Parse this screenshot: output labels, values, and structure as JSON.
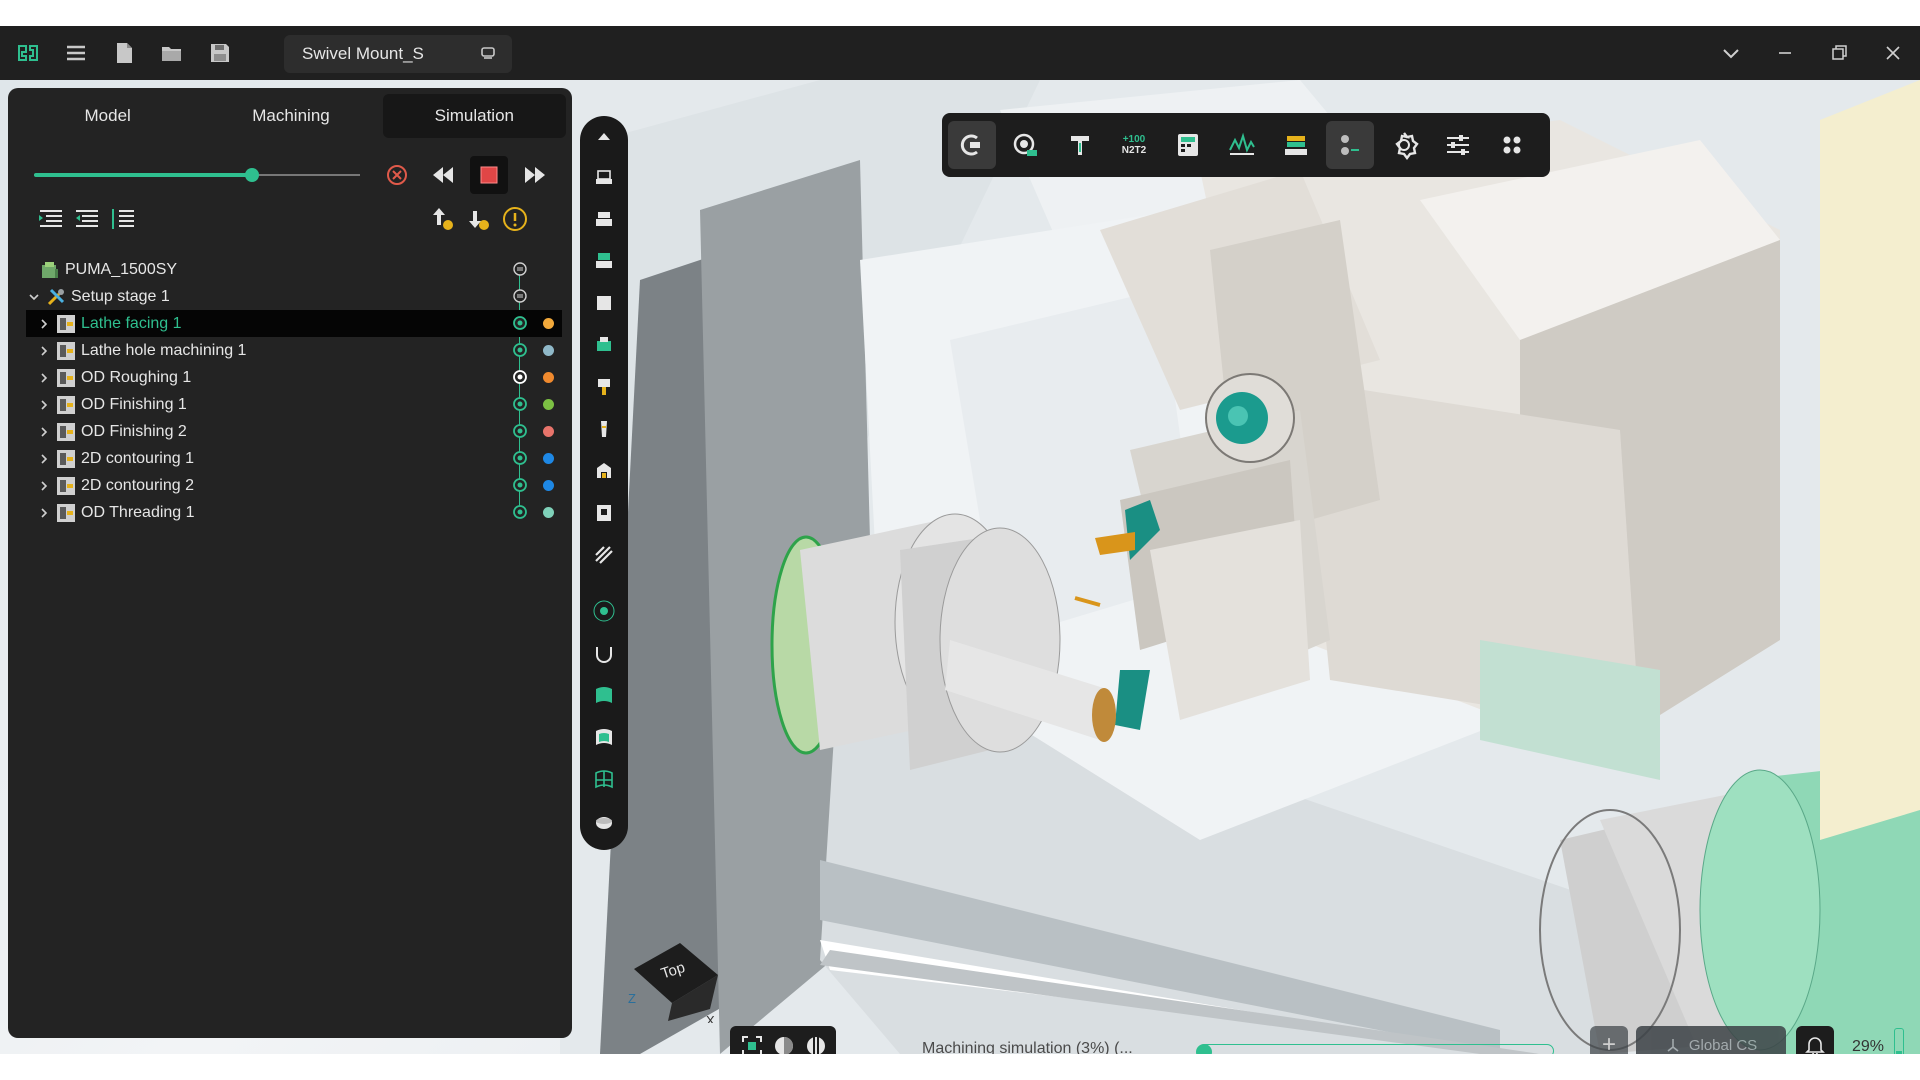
{
  "app": {
    "document_title": "Swivel Mount_S"
  },
  "tabs": [
    {
      "label": "Model",
      "active": false
    },
    {
      "label": "Machining",
      "active": false
    },
    {
      "label": "Simulation",
      "active": true
    }
  ],
  "playback": {
    "progress": 0.67
  },
  "tree": {
    "root": {
      "label": "PUMA_1500SY"
    },
    "setup": {
      "label": "Setup stage 1"
    },
    "operations": [
      {
        "label": "Lathe facing 1",
        "color": "#f2a93b",
        "selected": true
      },
      {
        "label": "Lathe hole machining 1",
        "color": "#8fb8c8"
      },
      {
        "label": "OD Roughing 1",
        "color": "#f08a2e"
      },
      {
        "label": "OD Finishing 1",
        "color": "#7cc043"
      },
      {
        "label": "OD Finishing 2",
        "color": "#e8746b"
      },
      {
        "label": "2D contouring 1",
        "color": "#1e88e5"
      },
      {
        "label": "2D contouring 2",
        "color": "#1e88e5"
      },
      {
        "label": "OD Threading 1",
        "color": "#7fd1b9"
      }
    ]
  },
  "top_toolbar": {
    "n2t2_label_top": "+100",
    "n2t2_label_bottom": "N2T2"
  },
  "status": {
    "text": "Machining simulation (3%) (...",
    "progress_percent": 3,
    "coordinate_system": "Global CS",
    "zoom": "29%"
  },
  "view_cube": {
    "face": "Top",
    "axis_z": "Z",
    "axis_x": "X"
  },
  "colors": {
    "accent": "#2fbf8f",
    "panel": "#232323",
    "toolbar": "#1d1d1d"
  }
}
